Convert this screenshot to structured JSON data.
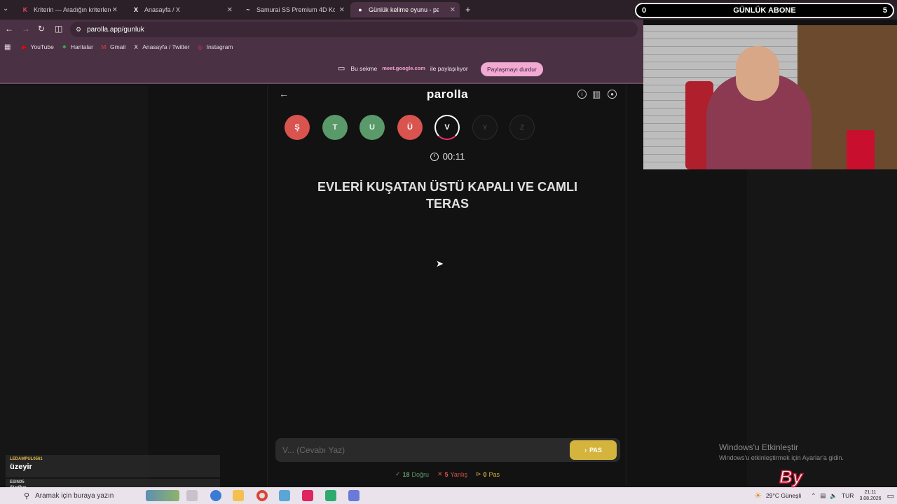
{
  "browser": {
    "tabs": [
      {
        "title": "Kriterin — Aradığın kriterlere k",
        "icon": "K"
      },
      {
        "title": "Anasayfa / X",
        "icon": "X"
      },
      {
        "title": "Samurai SS Premium 4D Kolçak",
        "icon": "~"
      },
      {
        "title": "Günlük kelime oyunu - par",
        "icon": "●",
        "active": true
      }
    ],
    "new_tab": "+",
    "url": "parolla.app/gunluk",
    "bookmarks": [
      {
        "label": "YouTube",
        "icon_color": "#ff0000"
      },
      {
        "label": "Haritalar",
        "icon_color": "#34a853"
      },
      {
        "label": "Gmail",
        "icon_color": "#ea4335"
      },
      {
        "label": "Anasayfa / Twitter",
        "icon_color": "#ffffff"
      },
      {
        "label": "Instagram",
        "icon_color": "#e1306c"
      }
    ],
    "share": {
      "prefix": "Bu sekme",
      "host": "meet.google.com",
      "suffix": "ile paylaşılıyor",
      "stop_button": "Paylaşmayı durdur"
    }
  },
  "game": {
    "logo": "parolla",
    "letters": [
      {
        "char": "Ş",
        "state": "red"
      },
      {
        "char": "T",
        "state": "green"
      },
      {
        "char": "U",
        "state": "green"
      },
      {
        "char": "Ü",
        "state": "red"
      },
      {
        "char": "V",
        "state": "current"
      },
      {
        "char": "Y",
        "state": "pending"
      },
      {
        "char": "Z",
        "state": "pending"
      }
    ],
    "timer": "00:11",
    "question": "EVLERİ KUŞATAN ÜSTÜ KAPALI VE CAMLI TERAS",
    "answer_placeholder": "V... (Cevabı Yaz)",
    "pass_button": "PAS",
    "stats": {
      "correct_count": "18",
      "correct_label": "Doğru",
      "wrong_count": "5",
      "wrong_label": "Yanlış",
      "pass_count": "0",
      "pass_label": "Pas"
    }
  },
  "overlay": {
    "cam_title": "GÜNLÜK ABONE",
    "cam_left": "0",
    "cam_right": "5",
    "chat": [
      {
        "user": "LEDAMPUL0561",
        "msg": "üzeyir"
      },
      {
        "user": "ESIN05",
        "msg": "ürün"
      }
    ],
    "windows_activation_title": "Windows'u Etkinleştir",
    "windows_activation_sub": "Windows'u etkinleştirmek için Ayarlar'a gidin."
  },
  "taskbar": {
    "search_placeholder": "Aramak için buraya yazın",
    "weather": "29°C  Güneşli",
    "lang": "TUR",
    "time": "21:11",
    "date": "3.08.2026"
  },
  "colors": {
    "red": "#d9534f",
    "green": "#5a9a6a",
    "pass_yellow": "#d4b43c",
    "browser_chrome": "#4a3143"
  }
}
